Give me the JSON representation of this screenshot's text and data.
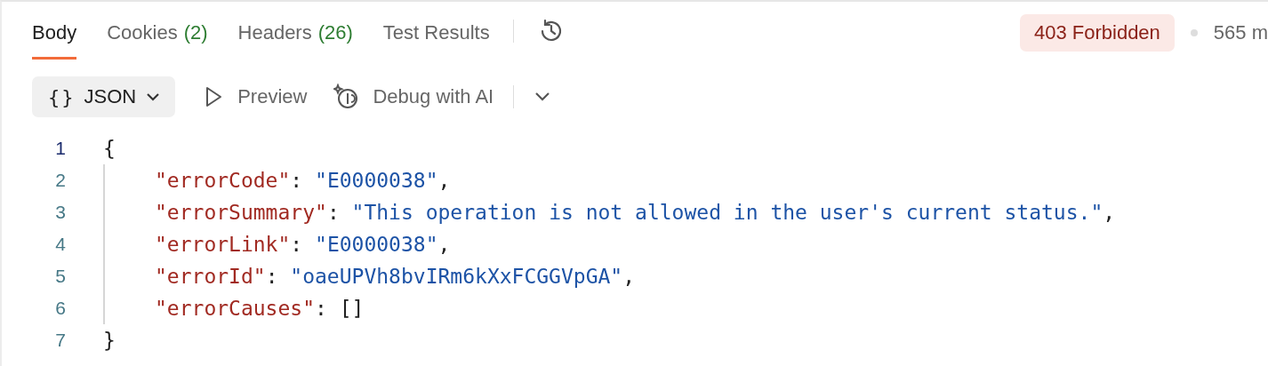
{
  "tabs": [
    {
      "label": "Body",
      "selected": true
    },
    {
      "label": "Cookies",
      "count": "(2)",
      "selected": false
    },
    {
      "label": "Headers",
      "count": "(26)",
      "selected": false
    },
    {
      "label": "Test Results",
      "selected": false
    }
  ],
  "status": {
    "code": "403 Forbidden",
    "time": "565 m"
  },
  "toolbar": {
    "format": "JSON",
    "format_icon": "{}",
    "preview": "Preview",
    "debug": "Debug with AI"
  },
  "code_lines": [
    {
      "number": "1",
      "active": true,
      "indent": false,
      "tokens": [
        {
          "kind": "punct",
          "text": "{"
        }
      ]
    },
    {
      "number": "2",
      "active": false,
      "indent": true,
      "tokens": [
        {
          "kind": "key",
          "text": "\"errorCode\""
        },
        {
          "kind": "punct",
          "text": ": "
        },
        {
          "kind": "string",
          "text": "\"E0000038\""
        },
        {
          "kind": "punct",
          "text": ","
        }
      ]
    },
    {
      "number": "3",
      "active": false,
      "indent": true,
      "tokens": [
        {
          "kind": "key",
          "text": "\"errorSummary\""
        },
        {
          "kind": "punct",
          "text": ": "
        },
        {
          "kind": "string",
          "text": "\"This operation is not allowed in the user's current status.\""
        },
        {
          "kind": "punct",
          "text": ","
        }
      ]
    },
    {
      "number": "4",
      "active": false,
      "indent": true,
      "tokens": [
        {
          "kind": "key",
          "text": "\"errorLink\""
        },
        {
          "kind": "punct",
          "text": ": "
        },
        {
          "kind": "string",
          "text": "\"E0000038\""
        },
        {
          "kind": "punct",
          "text": ","
        }
      ]
    },
    {
      "number": "5",
      "active": false,
      "indent": true,
      "tokens": [
        {
          "kind": "key",
          "text": "\"errorId\""
        },
        {
          "kind": "punct",
          "text": ": "
        },
        {
          "kind": "string",
          "text": "\"oaeUPVh8bvIRm6kXxFCGGVpGA\""
        },
        {
          "kind": "punct",
          "text": ","
        }
      ]
    },
    {
      "number": "6",
      "active": false,
      "indent": true,
      "tokens": [
        {
          "kind": "key",
          "text": "\"errorCauses\""
        },
        {
          "kind": "punct",
          "text": ": []"
        }
      ]
    },
    {
      "number": "7",
      "active": false,
      "indent": false,
      "tokens": [
        {
          "kind": "punct",
          "text": "}"
        }
      ]
    }
  ]
}
